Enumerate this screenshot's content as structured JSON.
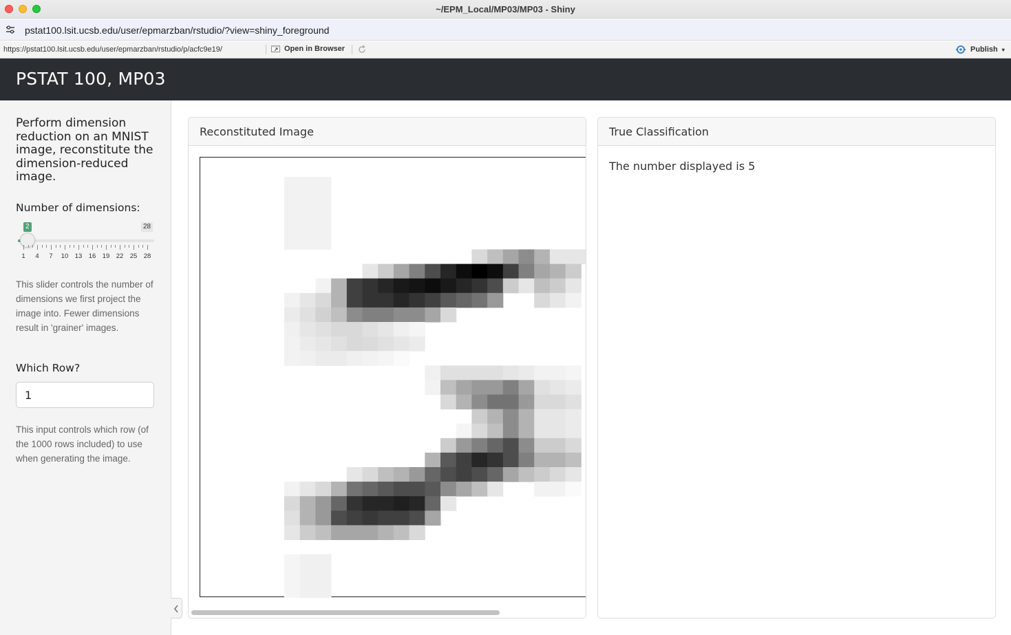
{
  "window": {
    "title": "~/EPM_Local/MP03/MP03 - Shiny"
  },
  "address_bar": {
    "url": "pstat100.lsit.ucsb.edu/user/epmarzban/rstudio/?view=shiny_foreground"
  },
  "viewer_toolbar": {
    "url": "https://pstat100.lsit.ucsb.edu/user/epmarzban/rstudio/p/acfc9e19/",
    "open_in_browser": "Open in Browser",
    "publish": "Publish"
  },
  "navbar": {
    "title": "PSTAT 100, MP03"
  },
  "sidebar": {
    "heading": "Perform dimension reduction on an MNIST image, reconstitute the dimension-reduced image.",
    "slider": {
      "label": "Number of dimensions:",
      "value": 2,
      "min": 1,
      "max": 28,
      "min_label": "2",
      "max_label": "28",
      "tick_labels": [
        "1",
        "4",
        "7",
        "10",
        "13",
        "16",
        "19",
        "22",
        "25",
        "28"
      ]
    },
    "slider_help": "This slider controls the number of dimensions we first project the image into. Fewer dimensions result in 'grainer' images.",
    "row_input": {
      "label": "Which Row?",
      "value": "1"
    },
    "row_help": "This input controls which row (of the 1000 rows included) to use when generating the image."
  },
  "panels": {
    "reconstituted": {
      "title": "Reconstituted Image"
    },
    "classification": {
      "title": "True Classification",
      "text": "The number displayed is 5"
    }
  },
  "image_pixels": {
    "description_cols": 28,
    "rows": [
      "0000000000000000000000000000",
      "0000000000000000000000000000",
      "0000000000000000000000000000",
      "0000000000000000000000000000",
      "0000000000000000000000000000",
      "000011100000000000000000000",
      "000011100000000000000000000",
      "000011100000000000000000000",
      "000011100000000000000000000",
      "000011100000000000000000000",
      "000000000000000000000000000",
      "000000000000000000000000000",
      "000000000000000000000000000"
    ]
  }
}
